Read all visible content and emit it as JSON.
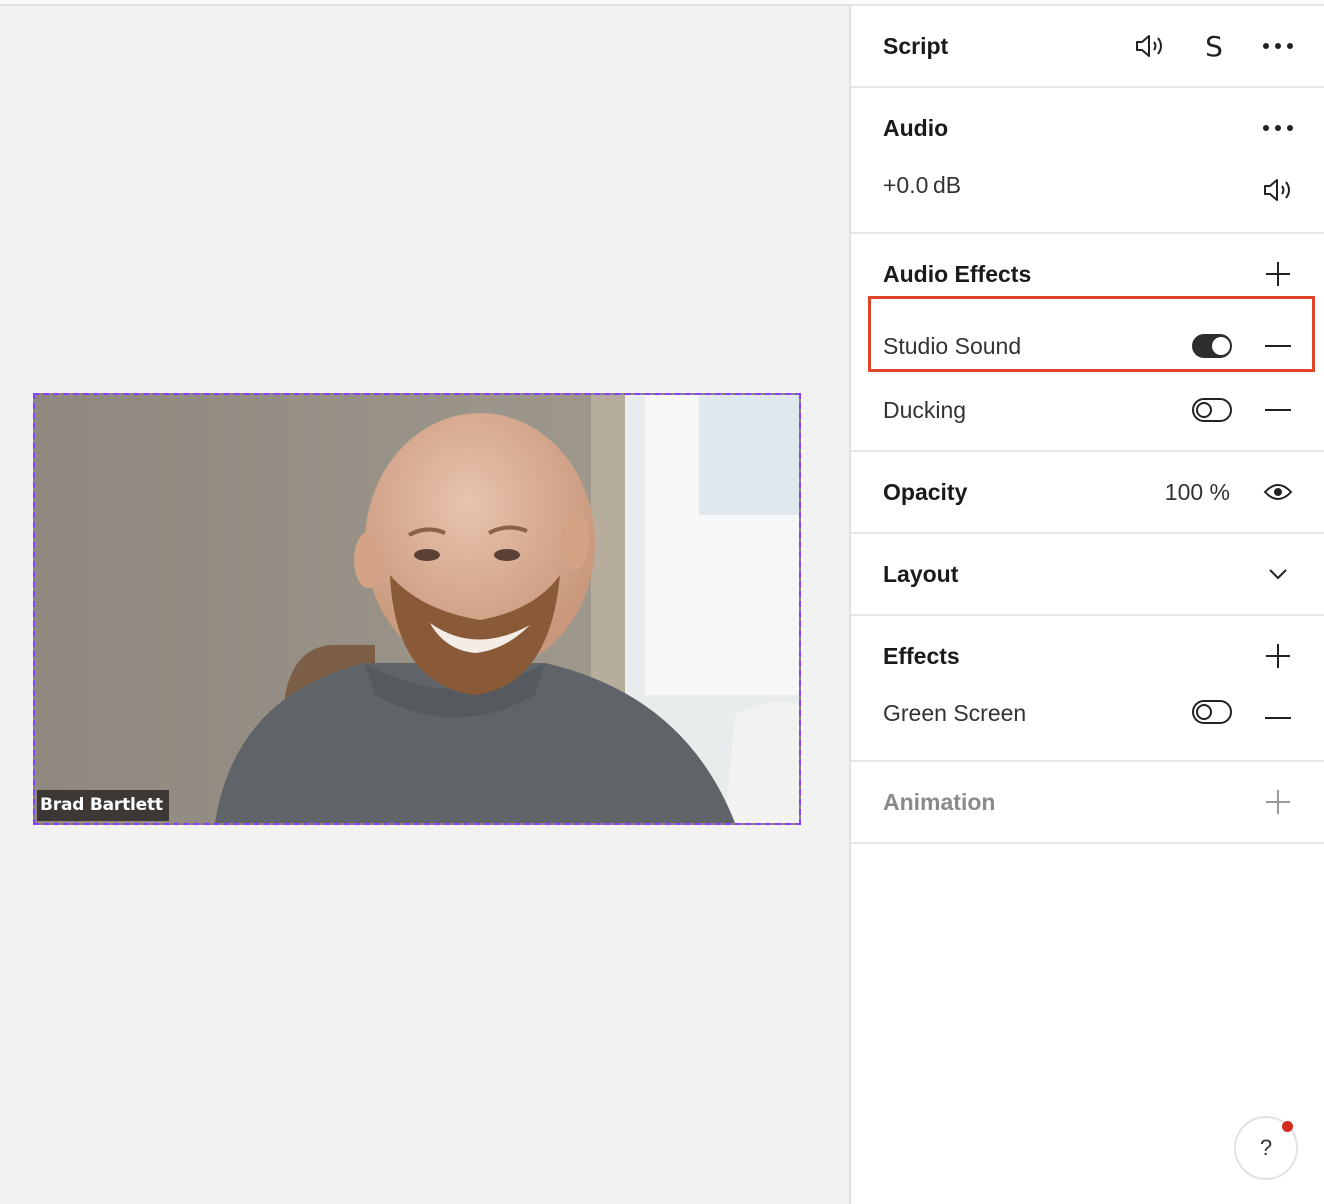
{
  "canvas": {
    "speaker_name": "Brad Bartlett"
  },
  "panel": {
    "script": {
      "title": "Script",
      "speaker_icon": "speaker-icon",
      "s_label": "S",
      "more_icon": "more-icon"
    },
    "audio": {
      "title": "Audio",
      "volume": "+0.0 dB",
      "more_icon": "more-icon",
      "speaker_icon": "speaker-icon"
    },
    "audio_effects": {
      "title": "Audio Effects",
      "items": [
        {
          "label": "Studio Sound",
          "enabled": true
        },
        {
          "label": "Ducking",
          "enabled": false
        }
      ]
    },
    "opacity": {
      "title": "Opacity",
      "value": "100 %",
      "icon": "eye-icon"
    },
    "layout": {
      "title": "Layout",
      "icon": "chevron-down-icon"
    },
    "effects": {
      "title": "Effects",
      "items": [
        {
          "label": "Green Screen",
          "enabled": false
        }
      ]
    },
    "animation": {
      "title": "Animation"
    }
  },
  "help": {
    "label": "?"
  },
  "colors": {
    "selection_border": "#8a3ffc",
    "highlight_box": "#e0452a",
    "notification_dot": "#d52b1e"
  }
}
